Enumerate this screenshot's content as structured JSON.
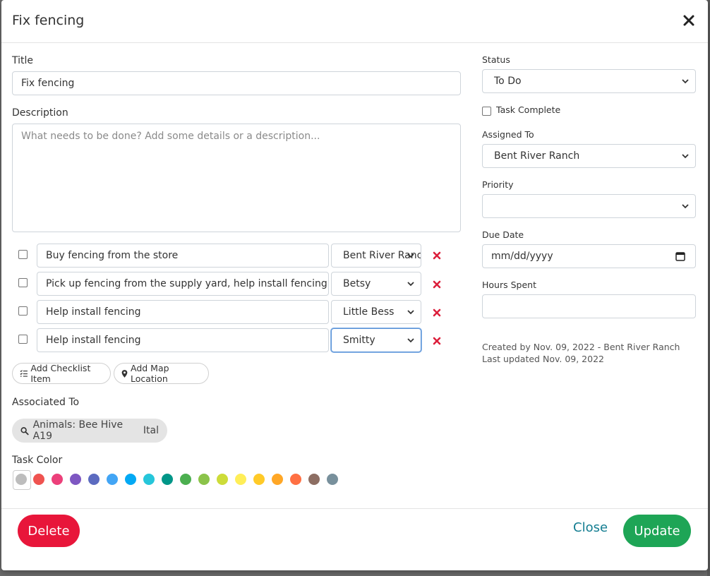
{
  "dialog": {
    "title": "Fix fencing"
  },
  "form": {
    "title_label": "Title",
    "title_value": "Fix fencing",
    "description_label": "Description",
    "description_placeholder": "What needs to be done? Add some details or a description..."
  },
  "checklist": [
    {
      "text": "Buy fencing from the store",
      "assignee": "Bent River Ranch",
      "checked": false
    },
    {
      "text": "Pick up fencing from the supply yard, help install fencing",
      "assignee": "Betsy",
      "checked": false
    },
    {
      "text": "Help install fencing",
      "assignee": "Little Bess",
      "checked": false
    },
    {
      "text": "Help install fencing",
      "assignee": "Smitty",
      "checked": false
    }
  ],
  "actions": {
    "add_checklist": "Add Checklist Item",
    "add_map": "Add Map Location"
  },
  "associated": {
    "label": "Associated To",
    "chip_text": "Animals: Bee Hive A19",
    "chip_suffix": "Ital"
  },
  "task_color": {
    "label": "Task Color",
    "colors": [
      "#bdbdbd",
      "#ef5350",
      "#ec407a",
      "#7e57c2",
      "#5c6bc0",
      "#42a5f5",
      "#03a9f4",
      "#26c6da",
      "#009688",
      "#4caf50",
      "#8bc34a",
      "#cddc39",
      "#ffee58",
      "#ffca28",
      "#ffa726",
      "#ff7043",
      "#8d6e63",
      "#78909c"
    ]
  },
  "sidebar": {
    "status_label": "Status",
    "status_value": "To Do",
    "task_complete_label": "Task Complete",
    "assigned_label": "Assigned To",
    "assigned_value": "Bent River Ranch",
    "priority_label": "Priority",
    "priority_value": "",
    "due_label": "Due Date",
    "due_placeholder": "mm/dd/yyyy",
    "hours_label": "Hours Spent",
    "hours_value": "",
    "created_text": "Created by Nov. 09, 2022 - Bent River Ranch",
    "updated_text": "Last updated Nov. 09, 2022"
  },
  "footer": {
    "delete_label": "Delete",
    "close_label": "Close",
    "update_label": "Update"
  }
}
